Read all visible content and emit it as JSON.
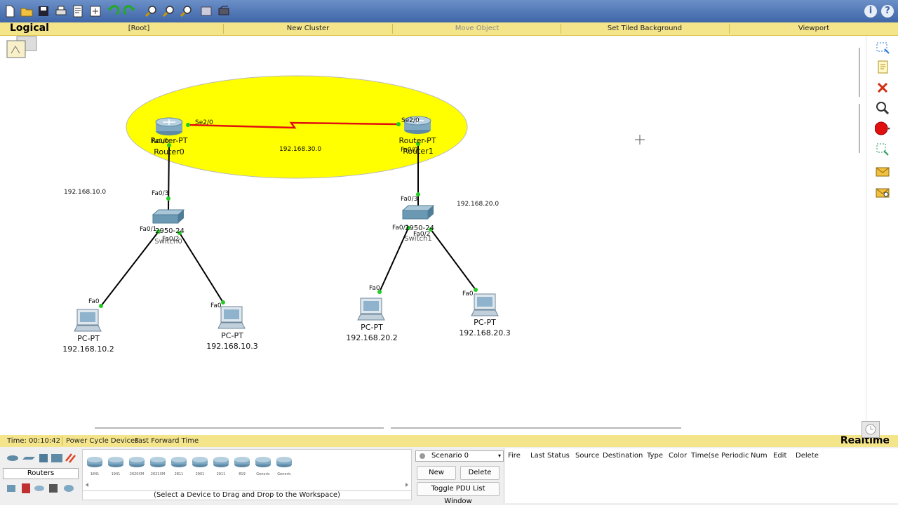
{
  "navbar": {
    "mode": "Logical",
    "root": "[Root]",
    "new_cluster": "New Cluster",
    "move_object": "Move Object",
    "set_tiled_background": "Set Tiled Background",
    "viewport": "Viewport"
  },
  "toolbar": {
    "icons": [
      "new-icon",
      "open-icon",
      "save-icon",
      "print-icon",
      "activity-wizard-icon",
      "custom-devices-icon",
      "undo-icon",
      "redo-icon",
      "zoom-in-icon",
      "zoom-reset-icon",
      "zoom-out-icon",
      "palette-icon",
      "device-template-icon"
    ]
  },
  "network": {
    "router0": {
      "model": "Router-PT",
      "name": "Router0",
      "port_se": "Se2/0",
      "port_fa": "Fa0/0"
    },
    "router1": {
      "model": "Router-PT",
      "name": "Router1",
      "port_se": "Se2/0",
      "port_fa": "Fa0/0"
    },
    "wan": "192.168.30.0",
    "lan0": "192.168.10.0",
    "lan1": "192.168.20.0",
    "switch0": {
      "model": "2950-24",
      "name": "Switch0",
      "fa03": "Fa0/3",
      "fa01": "Fa0/1",
      "fa02": "Fa0/2"
    },
    "switch1": {
      "model": "2950-24",
      "name": "Switch1",
      "fa03": "Fa0/3",
      "fa01": "Fa0/1",
      "fa02": "Fa0/2"
    },
    "pcs": [
      {
        "model": "PC-PT",
        "ip": "192.168.10.2",
        "port": "Fa0"
      },
      {
        "model": "PC-PT",
        "ip": "192.168.10.3",
        "port": "Fa0"
      },
      {
        "model": "PC-PT",
        "ip": "192.168.20.2",
        "port": "Fa0"
      },
      {
        "model": "PC-PT",
        "ip": "192.168.20.3",
        "port": "Fa0"
      }
    ]
  },
  "status": {
    "time": "Time: 00:10:42",
    "power_cycle": "Power Cycle Devices",
    "fast_forward": "Fast Forward Time",
    "realtime": "Realtime"
  },
  "bottom": {
    "category": "Routers",
    "devices": [
      "1841",
      "1941",
      "2620XM",
      "2621XM",
      "2811",
      "2901",
      "2911",
      "819",
      "Generic",
      "Generic"
    ],
    "hint": "(Select a Device to Drag and Drop to the Workspace)",
    "scenario": "Scenario 0",
    "new_label": "New",
    "delete_label": "Delete",
    "toggle_pdu": "Toggle PDU List Window",
    "pdu_columns": [
      "Fire",
      "Last Status",
      "Source",
      "Destination",
      "Type",
      "Color",
      "Time(se",
      "Periodic",
      "Num",
      "Edit",
      "Delete"
    ]
  },
  "colors": {
    "cluster_fill": "#ffff00",
    "serial_link": "#e01010",
    "toolbar": "#4a72b3",
    "navbar": "#f5e58a"
  }
}
